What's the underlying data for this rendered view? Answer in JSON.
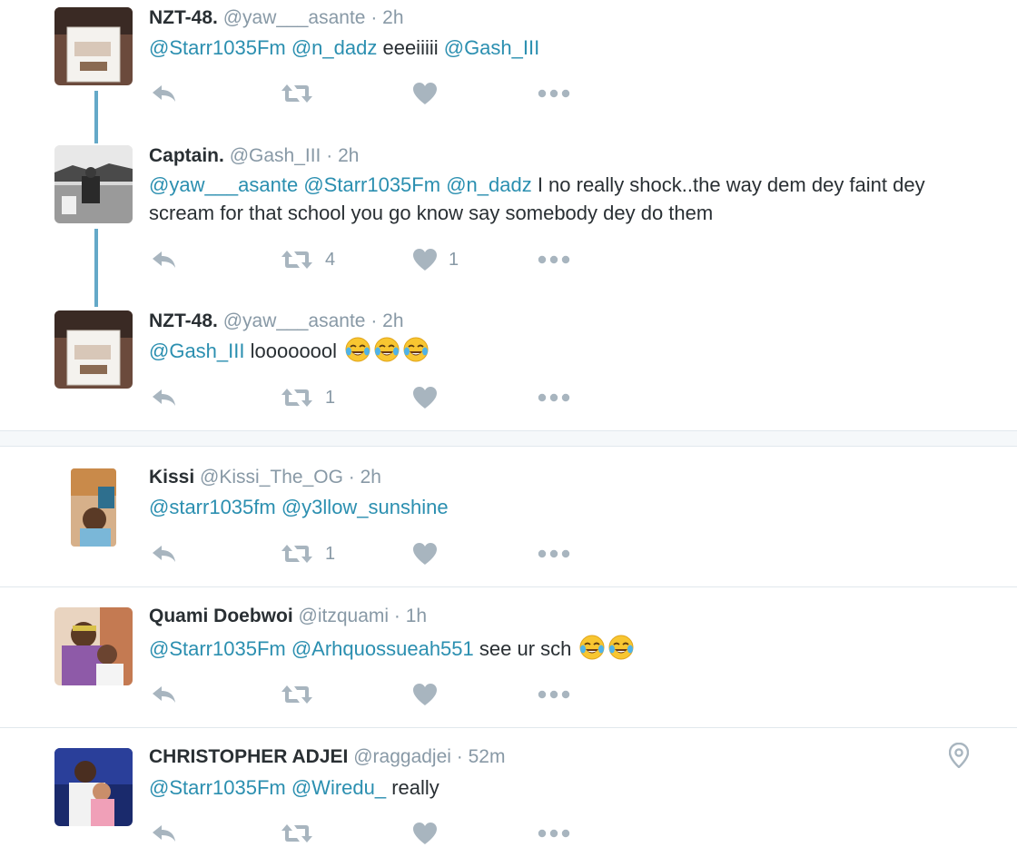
{
  "tweets": [
    {
      "name": "NZT-48.",
      "handle": "@yaw___asante",
      "time": "2h",
      "text": [
        {
          "t": "@Starr1035Fm",
          "mention": true
        },
        {
          "t": " "
        },
        {
          "t": "@n_dadz",
          "mention": true
        },
        {
          "t": " eeeiiiii "
        },
        {
          "t": "@Gash_III",
          "mention": true
        }
      ],
      "retweets": "",
      "likes": ""
    },
    {
      "name": "Captain.",
      "handle": "@Gash_III",
      "time": "2h",
      "text": [
        {
          "t": "@yaw___asante",
          "mention": true
        },
        {
          "t": " "
        },
        {
          "t": "@Starr1035Fm",
          "mention": true
        },
        {
          "t": " "
        },
        {
          "t": "@n_dadz",
          "mention": true
        },
        {
          "t": " I no really shock..the way dem dey faint dey scream for that school you go know say somebody dey do them"
        }
      ],
      "retweets": "4",
      "likes": "1"
    },
    {
      "name": "NZT-48.",
      "handle": "@yaw___asante",
      "time": "2h",
      "text": [
        {
          "t": "@Gash_III",
          "mention": true
        },
        {
          "t": " loooooool "
        },
        {
          "emoji": 3
        }
      ],
      "retweets": "1",
      "likes": ""
    },
    {
      "name": "Kissi",
      "handle": "@Kissi_The_OG",
      "time": "2h",
      "text": [
        {
          "t": "@starr1035fm",
          "mention": true
        },
        {
          "t": " "
        },
        {
          "t": "@y3llow_sunshine",
          "mention": true
        }
      ],
      "retweets": "1",
      "likes": ""
    },
    {
      "name": "Quami Doebwoi",
      "handle": "@itzquami",
      "time": "1h",
      "text": [
        {
          "t": "@Starr1035Fm",
          "mention": true
        },
        {
          "t": " "
        },
        {
          "t": "@Arhquossueah551",
          "mention": true
        },
        {
          "t": "  see ur sch "
        },
        {
          "emoji": 2
        }
      ],
      "retweets": "",
      "likes": ""
    },
    {
      "name": "CHRISTOPHER ADJEI",
      "handle": "@raggadjei",
      "time": "52m",
      "text": [
        {
          "t": "@Starr1035Fm",
          "mention": true
        },
        {
          "t": " "
        },
        {
          "t": "@Wiredu_",
          "mention": true
        },
        {
          "t": " really"
        }
      ],
      "retweets": "",
      "likes": ""
    }
  ],
  "icons": {
    "reply": "reply-icon",
    "retweet": "retweet-icon",
    "like": "heart-icon",
    "more": "more-icon",
    "location": "location-pin-icon",
    "emoji": "tears-of-joy-emoji"
  },
  "colors": {
    "mention": "#2b8fb0",
    "thread_line": "#64a9c8",
    "meta": "#8899a6",
    "action_icon": "#a8b5bf"
  }
}
